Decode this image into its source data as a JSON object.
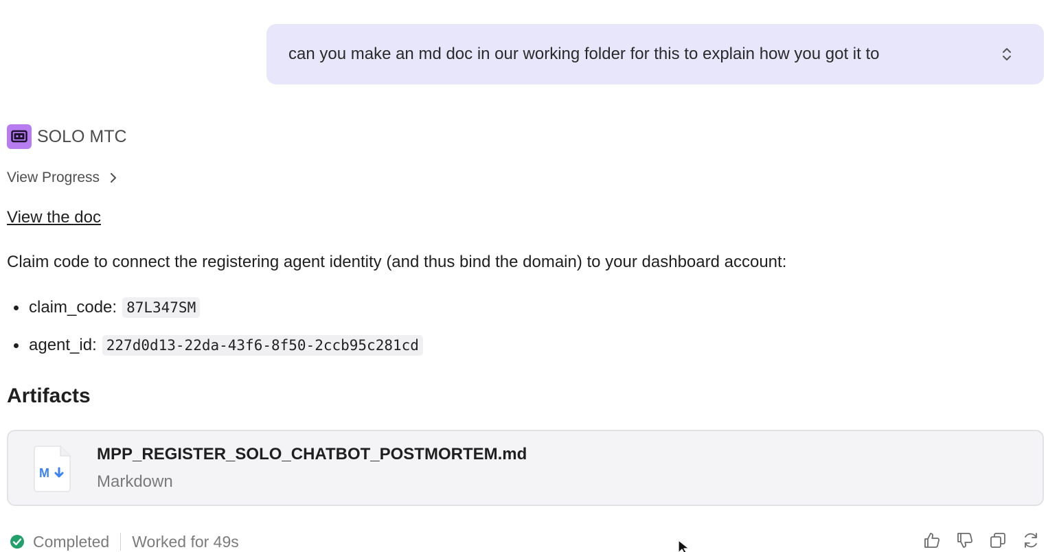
{
  "user_message": {
    "text": "can you make an md doc in our working folder for this to explain how you got it to"
  },
  "assistant": {
    "name": "SOLO MTC",
    "view_progress_label": "View Progress",
    "view_doc_label": "View the doc",
    "paragraph": "Claim code to connect the registering agent identity (and thus bind the domain) to your dashboard account:",
    "bullets": [
      {
        "label": "claim_code:",
        "value": "87L347SM"
      },
      {
        "label": "agent_id:",
        "value": "227d0d13-22da-43f6-8f50-2ccb95c281cd"
      }
    ]
  },
  "artifacts": {
    "title": "Artifacts",
    "items": [
      {
        "name": "MPP_REGISTER_SOLO_CHATBOT_POSTMORTEM.md",
        "type": "Markdown",
        "icon": "markdown-file-icon"
      }
    ]
  },
  "footer": {
    "status": "Completed",
    "status_color": "#22a06b",
    "worked": "Worked for 49s"
  },
  "colors": {
    "bubble": "#e8e6fb",
    "avatar": "#b77cf0",
    "markdown_blue": "#3b82f6"
  }
}
